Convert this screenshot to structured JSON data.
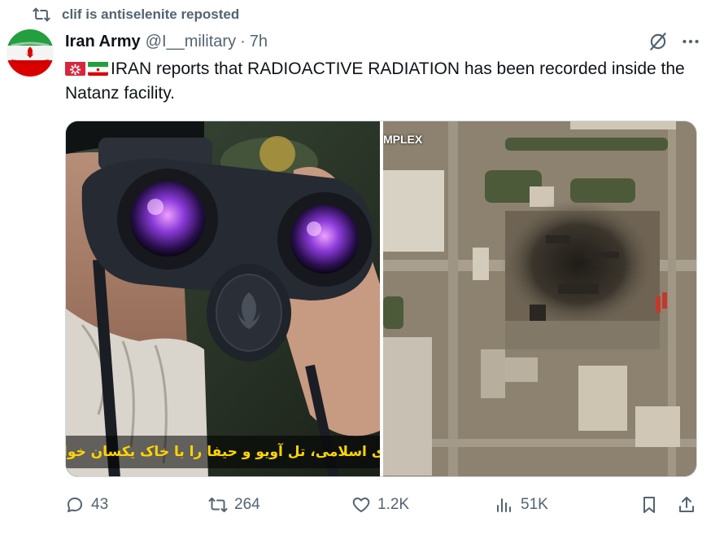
{
  "repost": {
    "text": "clif is antiselenite reposted",
    "icon": "repost-icon"
  },
  "author": {
    "name": "Iran Army",
    "handle": "@I__military",
    "separator": "·",
    "time": "7h",
    "avatar_icon": "iran-flag-avatar"
  },
  "tweet": {
    "emoji_1": "siren-emoji",
    "emoji_2": "iran-flag-emoji",
    "text": "IRAN reports that RADIOACTIVE RADIATION has been recorded inside the Natanz facility."
  },
  "media": {
    "left_image": "man-with-binoculars-photo",
    "left_caption": "جمهوری اسلامی، تل آویو و حیفا را با خاک یکسان خواهد کرد",
    "right_image": "satellite-image-natanz",
    "right_label": "MPLEX"
  },
  "actions": {
    "replies": "43",
    "reposts": "264",
    "likes": "1.2K",
    "views": "51K"
  },
  "colors": {
    "text_primary": "#0f1419",
    "text_secondary": "#536471",
    "border": "#cfd9de"
  }
}
